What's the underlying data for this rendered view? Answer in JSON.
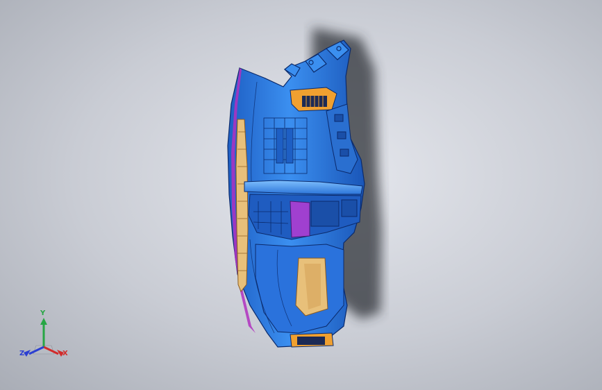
{
  "viewport": {
    "background_top": "#e6e8ee",
    "background_bottom": "#a9adb6"
  },
  "model": {
    "part_color": "#2f7de1",
    "edge_color": "#0b2a6b",
    "accent_orange": "#f0a030",
    "accent_magenta": "#b030c0",
    "accent_tan": "#e8c07a",
    "shadow_color": "#3a3d44"
  },
  "triad": {
    "y_label": "Y",
    "x_label": "X",
    "z_label": "Z",
    "y_color": "#27a644",
    "x_color": "#d22b2b",
    "z_color": "#2b3fd2"
  }
}
